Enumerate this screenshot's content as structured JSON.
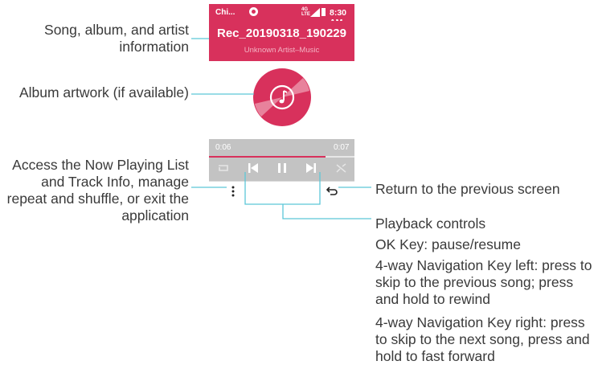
{
  "phone": {
    "status": {
      "carrier": "Chi...",
      "network": "4G LTE",
      "time": "8:30 AM"
    },
    "song": {
      "title": "Rec_20190318_190229",
      "subtitle": "Unknown Artist–Music"
    },
    "artwork_icon": "music-note-icon",
    "progress": {
      "elapsed": "0:06",
      "total": "0:07",
      "fraction": 0.8
    },
    "controls": [
      "repeat-icon",
      "previous-icon",
      "pause-icon",
      "next-icon",
      "shuffle-icon"
    ],
    "softkeys": {
      "left": "more-options-icon",
      "right": "back-icon"
    }
  },
  "callouts": {
    "song_info": "Song, album, and artist information",
    "artwork": "Album artwork (if available)",
    "options": "Access the Now Playing List and Track Info, manage repeat and shuffle, or exit the application",
    "return": "Return to the previous screen",
    "playback": "Playback controls",
    "ok_key": "OK Key: pause/resume",
    "nav_left": "4-way Navigation Key left: press to skip to the previous song; press and hold to rewind",
    "nav_right": "4-way Navigation Key right: press to skip to the next song, press and hold to fast forward"
  },
  "colors": {
    "accent": "#d8315c",
    "line": "#5cc7d8",
    "progress_bg": "#c3c3c3"
  }
}
